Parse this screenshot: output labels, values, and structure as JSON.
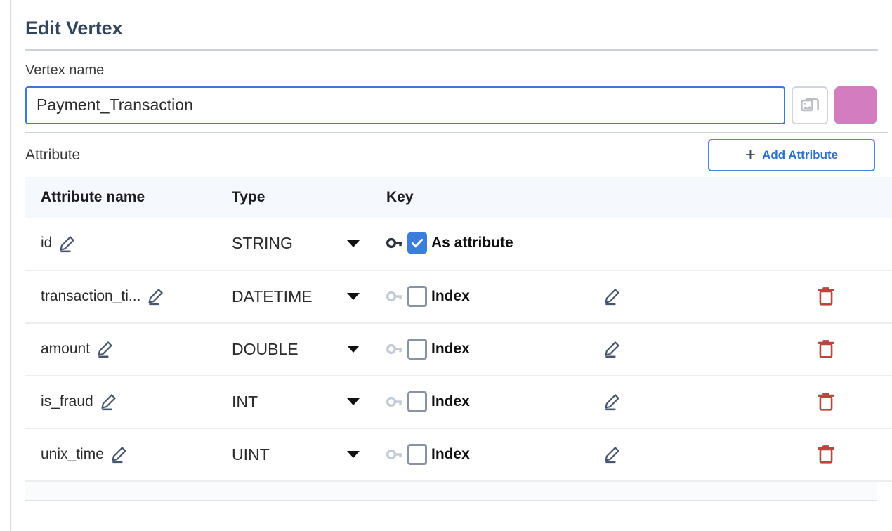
{
  "panel": {
    "title": "Edit Vertex"
  },
  "vertex_name": {
    "label": "Vertex name",
    "value": "Payment_Transaction",
    "placeholder": "Vertex name",
    "image_button_icon": "image-icon",
    "color_swatch": "#d37cc0"
  },
  "attribute_section": {
    "label": "Attribute",
    "add_button": {
      "plus": "+",
      "label": "Add Attribute"
    }
  },
  "table": {
    "headers": {
      "name": "Attribute name",
      "type": "Type",
      "key": "Key",
      "edit": "",
      "delete": ""
    },
    "rows": [
      {
        "name": "id",
        "type": "STRING",
        "key_label": "As attribute",
        "key_checked": true,
        "key_enabled": true,
        "has_edit": false,
        "has_delete": false
      },
      {
        "name": "transaction_ti...",
        "type": "DATETIME",
        "key_label": "Index",
        "key_checked": false,
        "key_enabled": false,
        "has_edit": true,
        "has_delete": true
      },
      {
        "name": "amount",
        "type": "DOUBLE",
        "key_label": "Index",
        "key_checked": false,
        "key_enabled": false,
        "has_edit": true,
        "has_delete": true
      },
      {
        "name": "is_fraud",
        "type": "INT",
        "key_label": "Index",
        "key_checked": false,
        "key_enabled": false,
        "has_edit": true,
        "has_delete": true
      },
      {
        "name": "unix_time",
        "type": "UINT",
        "key_label": "Index",
        "key_checked": false,
        "key_enabled": false,
        "has_edit": true,
        "has_delete": true
      }
    ]
  },
  "colors": {
    "accent_blue": "#3b7ddd",
    "title_slate": "#31455c",
    "delete_red": "#b9473f",
    "swatch_pink": "#d37cc0"
  }
}
